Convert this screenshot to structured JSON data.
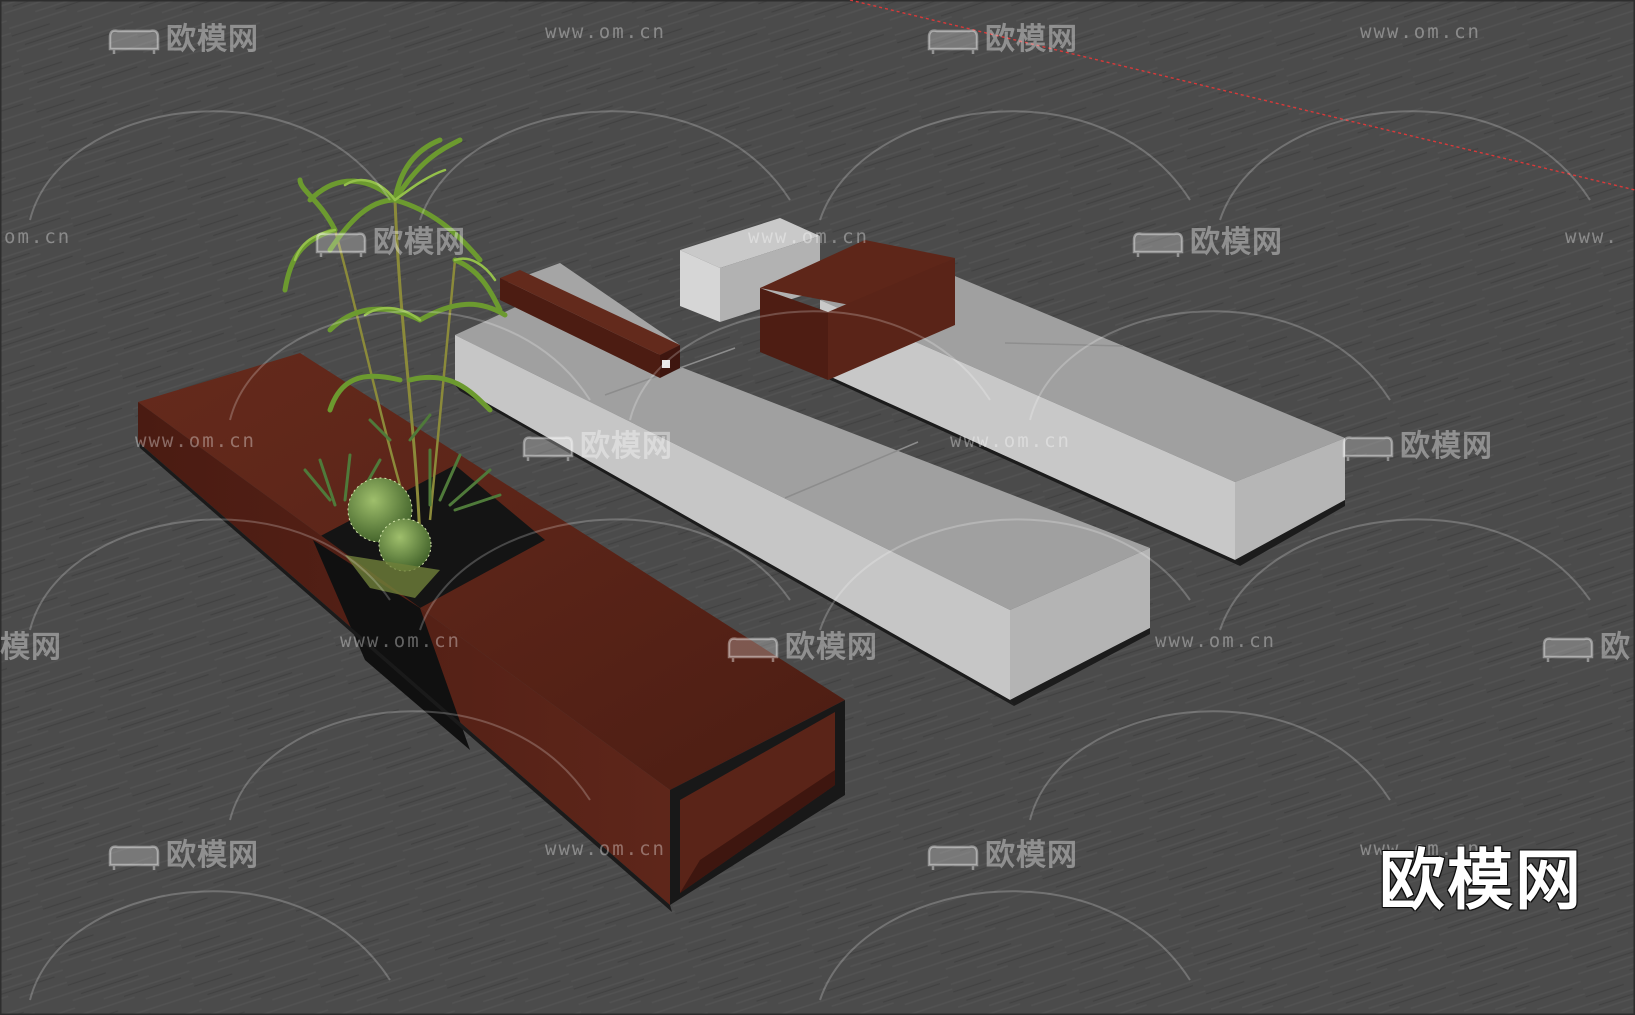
{
  "watermark": {
    "logo_text": "欧模网",
    "url_text": "www.om.cn",
    "url_partial_left": "om.cn",
    "url_partial_right": "www.",
    "logo_partial_left": "模网",
    "logo_partial_right": "欧"
  },
  "brand_logo_text": "欧模网",
  "colors": {
    "floor": "#4b4b4b",
    "wood": "#5a2418",
    "wood_dark": "#3e160f",
    "cushion_top": "#9d9d9d",
    "cushion_side": "#c4c4c4",
    "planter_black": "#141414",
    "axis_red": "#d83a3a"
  },
  "scene_objects": [
    "wooden-planter-bench",
    "gray-cushion-bench-middle",
    "gray-cushion-bench-right",
    "potted-palm-plant",
    "red-axis-guide-line"
  ]
}
